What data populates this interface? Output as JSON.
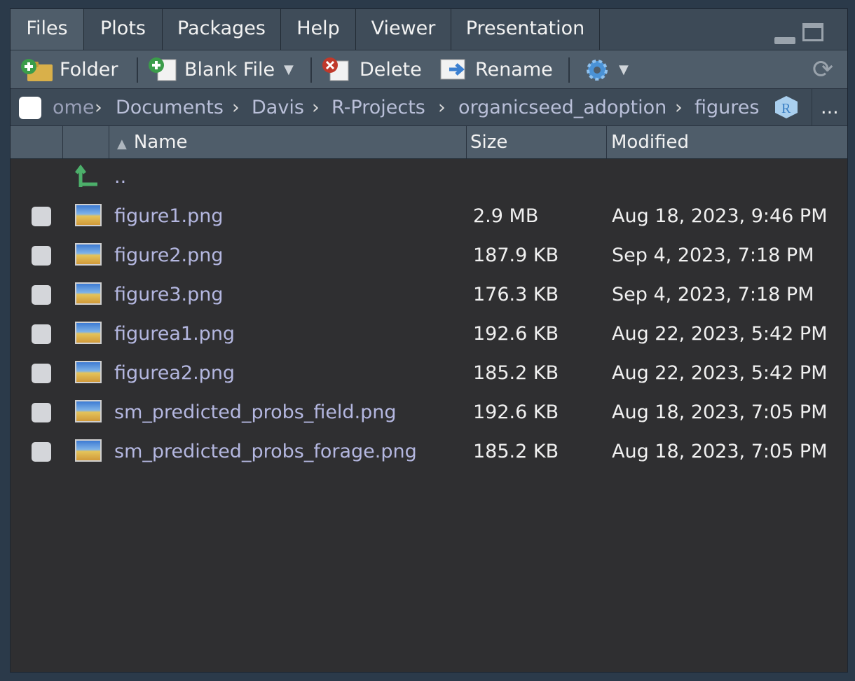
{
  "tabs": [
    {
      "label": "Files",
      "active": true
    },
    {
      "label": "Plots"
    },
    {
      "label": "Packages"
    },
    {
      "label": "Help"
    },
    {
      "label": "Viewer"
    },
    {
      "label": "Presentation"
    }
  ],
  "toolbar": {
    "folder_label": "Folder",
    "blank_file_label": "Blank File",
    "delete_label": "Delete",
    "rename_label": "Rename"
  },
  "breadcrumb": {
    "items": [
      "ome",
      "Documents",
      "Davis",
      "R-Projects",
      "organicseed_adoption",
      "figures"
    ],
    "more": "..."
  },
  "columns": {
    "name": "Name",
    "size": "Size",
    "modified": "Modified"
  },
  "parent_dir": "..",
  "files": [
    {
      "name": "figure1.png",
      "size": "2.9 MB",
      "modified": "Aug 18, 2023, 9:46 PM"
    },
    {
      "name": "figure2.png",
      "size": "187.9 KB",
      "modified": "Sep 4, 2023, 7:18 PM"
    },
    {
      "name": "figure3.png",
      "size": "176.3 KB",
      "modified": "Sep 4, 2023, 7:18 PM"
    },
    {
      "name": "figurea1.png",
      "size": "192.6 KB",
      "modified": "Aug 22, 2023, 5:42 PM"
    },
    {
      "name": "figurea2.png",
      "size": "185.2 KB",
      "modified": "Aug 22, 2023, 5:42 PM"
    },
    {
      "name": "sm_predicted_probs_field.png",
      "size": "192.6 KB",
      "modified": "Aug 18, 2023, 7:05 PM"
    },
    {
      "name": "sm_predicted_probs_forage.png",
      "size": "185.2 KB",
      "modified": "Aug 18, 2023, 7:05 PM"
    }
  ],
  "colors": {
    "accent": "#4f5d6a",
    "file_link": "#b4b7e0",
    "background": "#2f2f31"
  }
}
